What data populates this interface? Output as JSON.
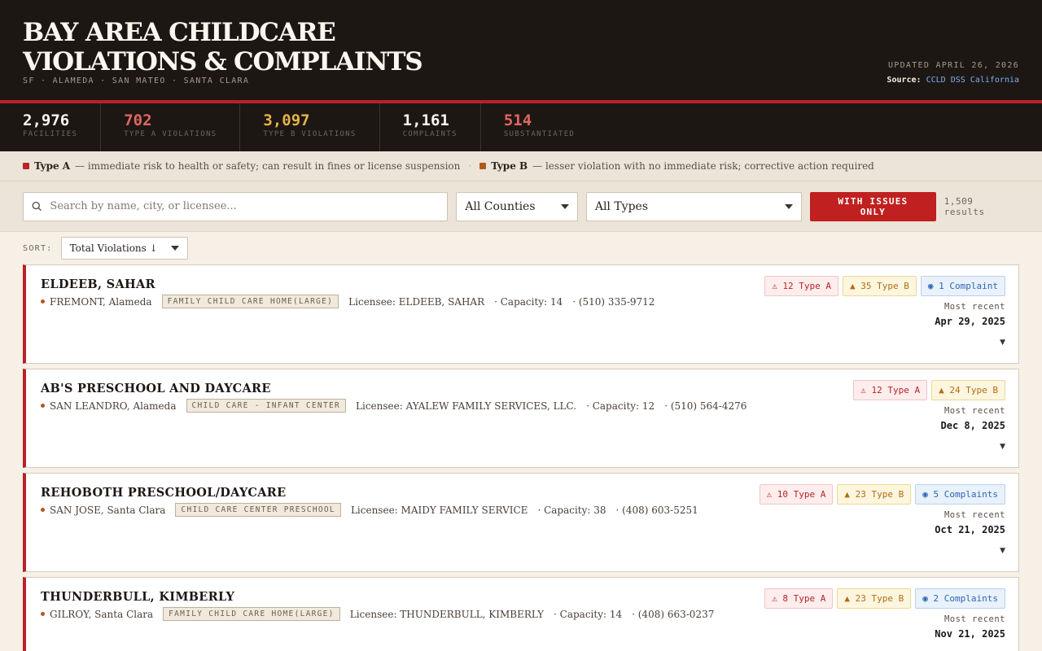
{
  "header": {
    "title_line1": "BAY AREA CHILDCARE",
    "title_line2": "VIOLATIONS & COMPLAINTS",
    "counties": "SF · ALAMEDA · SAN MATEO · SANTA CLARA",
    "updated": "UPDATED APRIL 26, 2026",
    "source_label": "Source:",
    "source_link": "CCLD DSS California"
  },
  "stats": [
    {
      "value": "2,976",
      "label": "FACILITIES",
      "color": "#fbf6ee"
    },
    {
      "value": "702",
      "label": "TYPE A VIOLATIONS",
      "color": "#e06661"
    },
    {
      "value": "3,097",
      "label": "TYPE B VIOLATIONS",
      "color": "#e3b448"
    },
    {
      "value": "1,161",
      "label": "COMPLAINTS",
      "color": "#fbf6ee"
    },
    {
      "value": "514",
      "label": "SUBSTANTIATED",
      "color": "#e06661"
    }
  ],
  "legend": {
    "a_title": "Type A",
    "a_desc": "— immediate risk to health or safety; can result in fines or license suspension",
    "sep": "·",
    "b_title": "Type B",
    "b_desc": "— lesser violation with no immediate risk; corrective action required",
    "a_color": "#b82326",
    "b_color": "#b3581c"
  },
  "filters": {
    "search_placeholder": "Search by name, city, or licensee...",
    "county_select": "All Counties",
    "type_select": "All Types",
    "issues_button": "WITH ISSUES ONLY",
    "results": "1,509 results"
  },
  "sort": {
    "label": "SORT:",
    "value": "Total Violations ↓"
  },
  "facilities": [
    {
      "name": "ELDEEB, SAHAR",
      "location": "FREMONT, Alameda",
      "type": "FAMILY CHILD CARE HOME(LARGE)",
      "licensee": "Licensee: ELDEEB, SAHAR",
      "capacity": "· Capacity: 14",
      "phone": "· (510) 335-9712",
      "type_a": "⚠ 12 Type A",
      "type_b": "▲ 35 Type B",
      "complaints": "◉ 1 Complaint",
      "recent_label": "Most recent",
      "recent_date": "Apr 29, 2025",
      "expand": "▼"
    },
    {
      "name": "AB'S PRESCHOOL AND DAYCARE",
      "location": "SAN LEANDRO, Alameda",
      "type": "CHILD CARE - INFANT CENTER",
      "licensee": "Licensee: AYALEW FAMILY SERVICES, LLC.",
      "capacity": "· Capacity: 12",
      "phone": "· (510) 564-4276",
      "type_a": "⚠ 12 Type A",
      "type_b": "▲ 24 Type B",
      "complaints": "",
      "recent_label": "Most recent",
      "recent_date": "Dec 8, 2025",
      "expand": "▼"
    },
    {
      "name": "REHOBOTH PRESCHOOL/DAYCARE",
      "location": "SAN JOSE, Santa Clara",
      "type": "CHILD CARE CENTER PRESCHOOL",
      "licensee": "Licensee: MAIDY FAMILY SERVICE",
      "capacity": "· Capacity: 38",
      "phone": "· (408) 603-5251",
      "type_a": "⚠ 10 Type A",
      "type_b": "▲ 23 Type B",
      "complaints": "◉ 5 Complaints",
      "recent_label": "Most recent",
      "recent_date": "Oct 21, 2025",
      "expand": "▼"
    },
    {
      "name": "THUNDERBULL, KIMBERLY",
      "location": "GILROY, Santa Clara",
      "type": "FAMILY CHILD CARE HOME(LARGE)",
      "licensee": "Licensee: THUNDERBULL, KIMBERLY",
      "capacity": "· Capacity: 14",
      "phone": "· (408) 663-0237",
      "type_a": "⚠ 8 Type A",
      "type_b": "▲ 23 Type B",
      "complaints": "◉ 2 Complaints",
      "recent_label": "Most recent",
      "recent_date": "Nov 21, 2025",
      "expand": "▼"
    }
  ]
}
